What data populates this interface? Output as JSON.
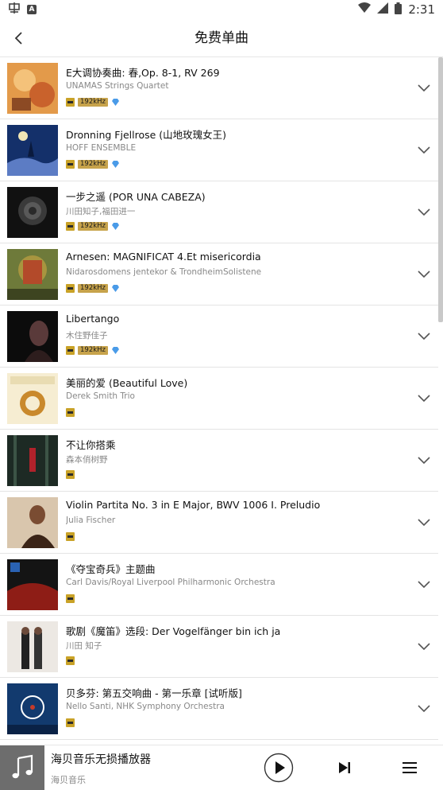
{
  "status_bar": {
    "time": "2:31",
    "left_icons": [
      "app-notification-icon",
      "a-square-icon"
    ],
    "right_icons": [
      "wifi-icon",
      "signal-icon",
      "battery-icon"
    ]
  },
  "header": {
    "title": "免费单曲",
    "back_icon": "chevron-left-icon"
  },
  "songs": [
    {
      "title": "E大调协奏曲: 春,Op. 8-1, RV 269",
      "artist": "UNAMAS Strings Quartet",
      "sample_rate": "192kHz",
      "diamond": true
    },
    {
      "title": "Dronning Fjellrose (山地玫瑰女王)",
      "artist": "HOFF ENSEMBLE",
      "sample_rate": "192kHz",
      "diamond": true
    },
    {
      "title": "一步之遥 (POR UNA CABEZA)",
      "artist": "川田知子,福田进一",
      "sample_rate": "192kHz",
      "diamond": true
    },
    {
      "title": "Arnesen: MAGNIFICAT 4.Et misericordia",
      "artist": "Nidarosdomens jentekor & TrondheimSolistene",
      "sample_rate": "192kHz",
      "diamond": true
    },
    {
      "title": "Libertango",
      "artist": "木住野佳子",
      "sample_rate": "192kHz",
      "diamond": true
    },
    {
      "title": "美丽的爱 (Beautiful Love)",
      "artist": "Derek Smith Trio",
      "sample_rate": "",
      "diamond": false
    },
    {
      "title": "不让你搭乘",
      "artist": "森本俏树野",
      "sample_rate": "",
      "diamond": false
    },
    {
      "title": "Violin Partita No. 3 in E Major, BWV 1006  I. Preludio",
      "artist": "Julia Fischer",
      "sample_rate": "",
      "diamond": false
    },
    {
      "title": "《夺宝奇兵》主题曲",
      "artist": "Carl Davis/Royal Liverpool Philharmonic Orchestra",
      "sample_rate": "",
      "diamond": false
    },
    {
      "title": "歌剧《魔笛》选段: Der Vogelfänger bin ich ja",
      "artist": "川田 知子",
      "sample_rate": "",
      "diamond": false
    },
    {
      "title": "贝多芬: 第五交响曲 - 第一乐章 [试听版]",
      "artist": "Nello Santi, NHK Symphony Orchestra",
      "sample_rate": "",
      "diamond": false
    }
  ],
  "player": {
    "title": "海贝音乐无损播放器",
    "subtitle": "海贝音乐",
    "icons": [
      "music-note-icon",
      "play-icon",
      "skip-next-icon",
      "playlist-icon"
    ]
  },
  "colors": {
    "hires_gold": "#c9a227",
    "khz_badge": "#c7a34b",
    "diamond_blue": "#4a9be8",
    "divider": "#e4e4e4"
  }
}
